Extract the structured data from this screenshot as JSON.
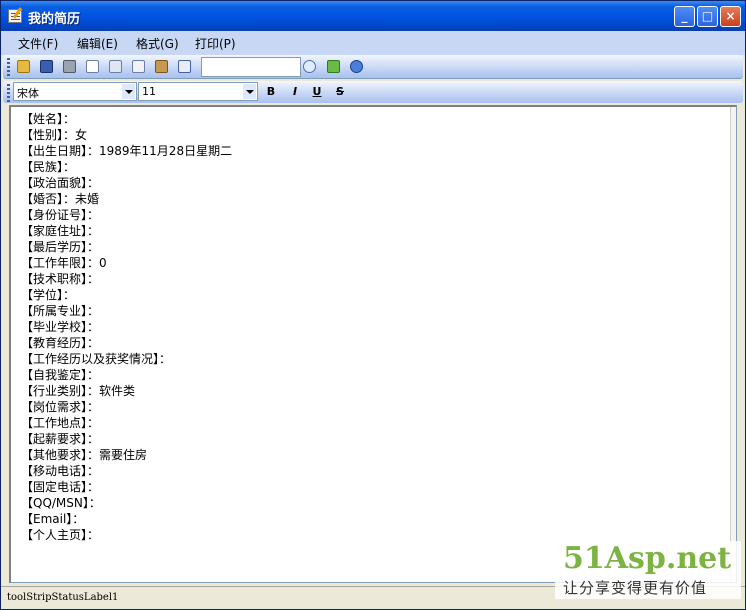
{
  "window": {
    "title": "我的简历"
  },
  "menu": [
    {
      "label": "文件(F)"
    },
    {
      "label": "编辑(E)"
    },
    {
      "label": "格式(G)"
    },
    {
      "label": "打印(P)"
    }
  ],
  "toolbar": {
    "icons": [
      "open-icon",
      "save-icon",
      "print-icon",
      "preview-icon",
      "cut-icon",
      "copy-icon",
      "paste-icon",
      "undo-icon",
      "find-icon",
      "export-icon",
      "info-icon"
    ],
    "search_value": ""
  },
  "format_bar": {
    "font_name": "宋体",
    "font_size": "11",
    "bold": "B",
    "italic": "I",
    "underline": "U",
    "strike": "S"
  },
  "resume_lines": [
    "【姓名】：",
    "【性别】：女",
    "【出生日期】：1989年11月28日星期二",
    "【民族】：",
    "【政治面貌】：",
    "【婚否】：未婚",
    "【身份证号】：",
    "【家庭住址】：",
    "【最后学历】：",
    "【工作年限】：0",
    "【技术职称】：",
    "【学位】：",
    "【所属专业】：",
    "【毕业学校】：",
    "【教育经历】：",
    "【工作经历以及获奖情况】：",
    "【自我鉴定】：",
    "【行业类别】：软件类",
    "【岗位需求】：",
    "【工作地点】：",
    "【起薪要求】：",
    "【其他要求】：需要住房",
    "【移动电话】：",
    "【固定电话】：",
    "【QQ/MSN】：",
    "【Email】：",
    "【个人主页】："
  ],
  "status": {
    "label": "toolStripStatusLabel1"
  },
  "watermark": {
    "title": "51Asp.net",
    "slogan": "让分享变得更有价值"
  },
  "colors": {
    "titlebar": "#0054e3",
    "menubar": "#c8d8f4",
    "watermark_green": "#7cb342"
  }
}
